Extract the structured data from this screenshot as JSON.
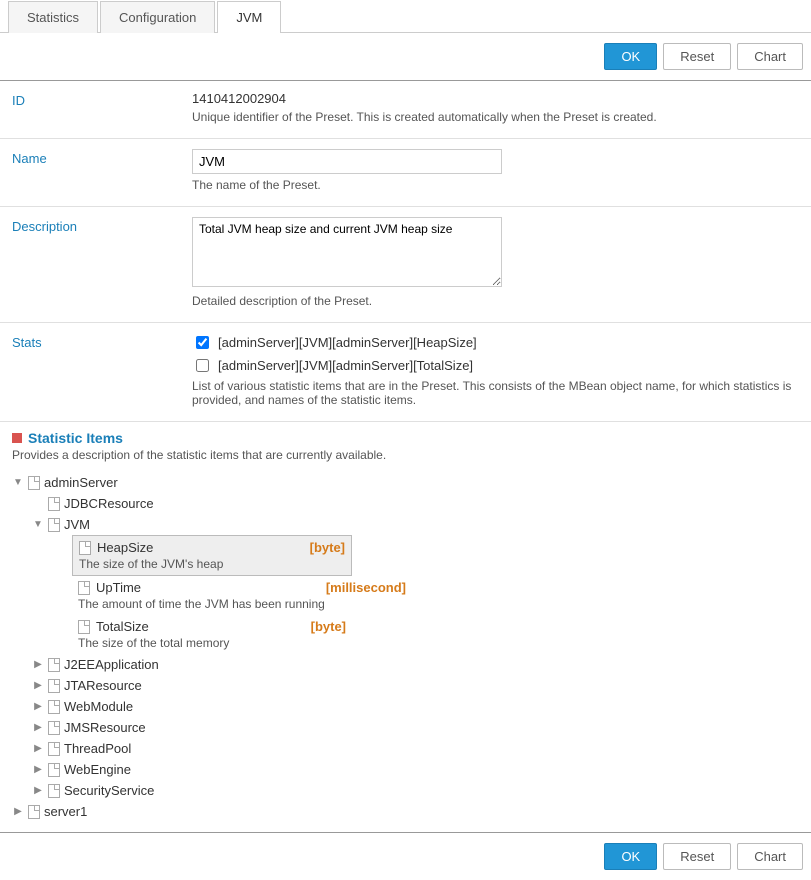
{
  "tabs": {
    "stats": "Statistics",
    "config": "Configuration",
    "jvm": "JVM"
  },
  "buttons": {
    "ok": "OK",
    "reset": "Reset",
    "chart": "Chart"
  },
  "fields": {
    "id": {
      "label": "ID",
      "value": "1410412002904",
      "help": "Unique identifier of the Preset. This is created automatically when the Preset is created."
    },
    "name": {
      "label": "Name",
      "value": "JVM",
      "help": "The name of the Preset."
    },
    "description": {
      "label": "Description",
      "value": "Total JVM heap size and current JVM heap size",
      "help": "Detailed description of the Preset."
    },
    "stats": {
      "label": "Stats",
      "items": [
        {
          "checked": true,
          "text": "[adminServer][JVM][adminServer][HeapSize]"
        },
        {
          "checked": false,
          "text": "[adminServer][JVM][adminServer][TotalSize]"
        }
      ],
      "help": "List of various statistic items that are in the Preset. This consists of the MBean object name, for which statistics is provided, and names of the statistic items."
    }
  },
  "section": {
    "title": "Statistic Items",
    "desc": "Provides a description of the statistic items that are currently available."
  },
  "tree": {
    "admin": "adminServer",
    "jdbc": "JDBCResource",
    "jvm": "JVM",
    "leaves": {
      "heap": {
        "name": "HeapSize",
        "unit": "[byte]",
        "desc": "The size of the JVM's heap"
      },
      "uptime": {
        "name": "UpTime",
        "unit": "[millisecond]",
        "desc": "The amount of time the JVM has been running"
      },
      "total": {
        "name": "TotalSize",
        "unit": "[byte]",
        "desc": "The size of the total memory"
      }
    },
    "others": [
      "J2EEApplication",
      "JTAResource",
      "WebModule",
      "JMSResource",
      "ThreadPool",
      "WebEngine",
      "SecurityService"
    ],
    "server1": "server1"
  }
}
